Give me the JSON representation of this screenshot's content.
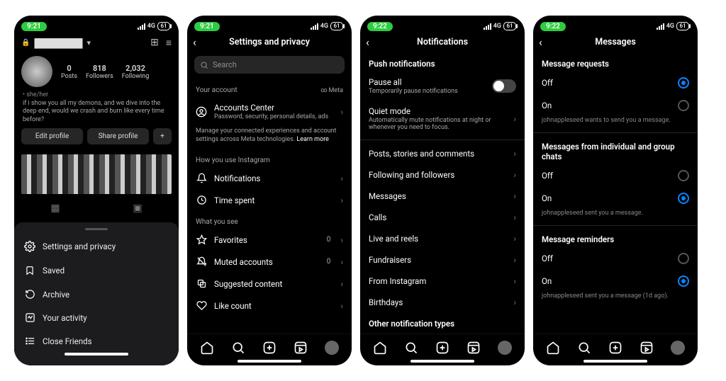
{
  "status": {
    "time1": "9:21",
    "time2": "9:21",
    "time3": "9:22",
    "time4": "9:22",
    "net": "4G",
    "battery": "61"
  },
  "screen1": {
    "username": "████████",
    "posts_n": "0",
    "posts_l": "Posts",
    "followers_n": "818",
    "followers_l": "Followers",
    "following_n": "2,032",
    "following_l": "Following",
    "pronouns": "• she/her",
    "bio": "if i show you all my demons, and we dive into the deep end, would we crash and burn like every time before?",
    "edit": "Edit profile",
    "share": "Share profile",
    "sheet": {
      "settings": "Settings and privacy",
      "saved": "Saved",
      "archive": "Archive",
      "activity": "Your activity",
      "close": "Close Friends"
    }
  },
  "screen2": {
    "title": "Settings and privacy",
    "search_ph": "Search",
    "sect_account": "Your account",
    "meta": "Meta",
    "accounts_center": "Accounts Center",
    "accounts_sub": "Password, security, personal details, ads",
    "accounts_note": "Manage your connected experiences and account settings across Meta technologies.",
    "learn_more": "Learn more",
    "sect_how": "How you use Instagram",
    "notifications": "Notifications",
    "time_spent": "Time spent",
    "sect_what": "What you see",
    "favorites": "Favorites",
    "fav_n": "0",
    "muted": "Muted accounts",
    "muted_n": "0",
    "suggested": "Suggested content",
    "like_count": "Like count"
  },
  "screen3": {
    "title": "Notifications",
    "push": "Push notifications",
    "pause": "Pause all",
    "pause_sub": "Temporarily pause notifications",
    "quiet": "Quiet mode",
    "quiet_sub": "Automatically mute notifications at night or whenever you need to focus.",
    "items": {
      "posts": "Posts, stories and comments",
      "following": "Following and followers",
      "messages": "Messages",
      "calls": "Calls",
      "live": "Live and reels",
      "fund": "Fundraisers",
      "from_ig": "From Instagram",
      "birthdays": "Birthdays"
    },
    "other": "Other notification types"
  },
  "screen4": {
    "title": "Messages",
    "sect_req": "Message requests",
    "off": "Off",
    "on": "On",
    "req_example": "johnappleseed wants to send you a message.",
    "sect_chats": "Messages from individual and group chats",
    "chats_example": "johnappleseed sent you a message.",
    "sect_reminders": "Message reminders",
    "rem_example": "johnappleseed sent you a message (1d ago)."
  }
}
